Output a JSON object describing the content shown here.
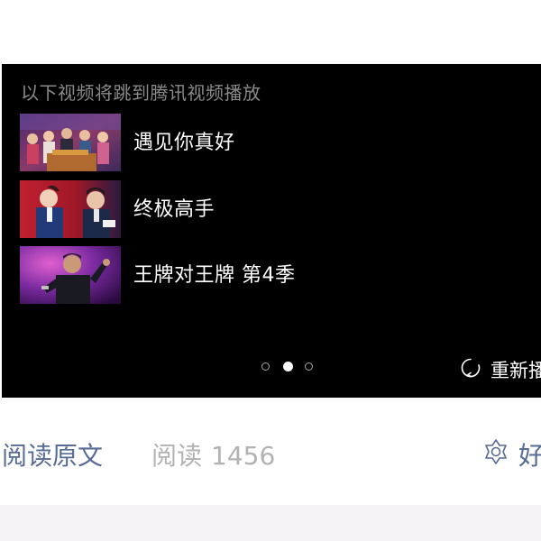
{
  "video_panel": {
    "notice": "以下视频将跳到腾讯视频播放",
    "recommendations": [
      {
        "title": "遇见你真好",
        "thumbnail": "group-cast-thumbnail"
      },
      {
        "title": "终极高手",
        "thumbnail": "two-men-thumbnail"
      },
      {
        "title": "王牌对王牌 第4季",
        "thumbnail": "singer-stage-thumbnail"
      }
    ],
    "pager": {
      "pages": 3,
      "active_index": 1
    },
    "replay_label": "重新播",
    "replay_icon": "replay-icon"
  },
  "footer": {
    "read_original": "阅读原文",
    "read_label": "阅读",
    "read_count": "1456",
    "like_label": "好",
    "like_icon": "like-flower-icon"
  },
  "colors": {
    "link": "#576b95",
    "muted": "#b2b2b2",
    "panel_bg": "#000000",
    "notice_text": "#8a8a8a"
  }
}
